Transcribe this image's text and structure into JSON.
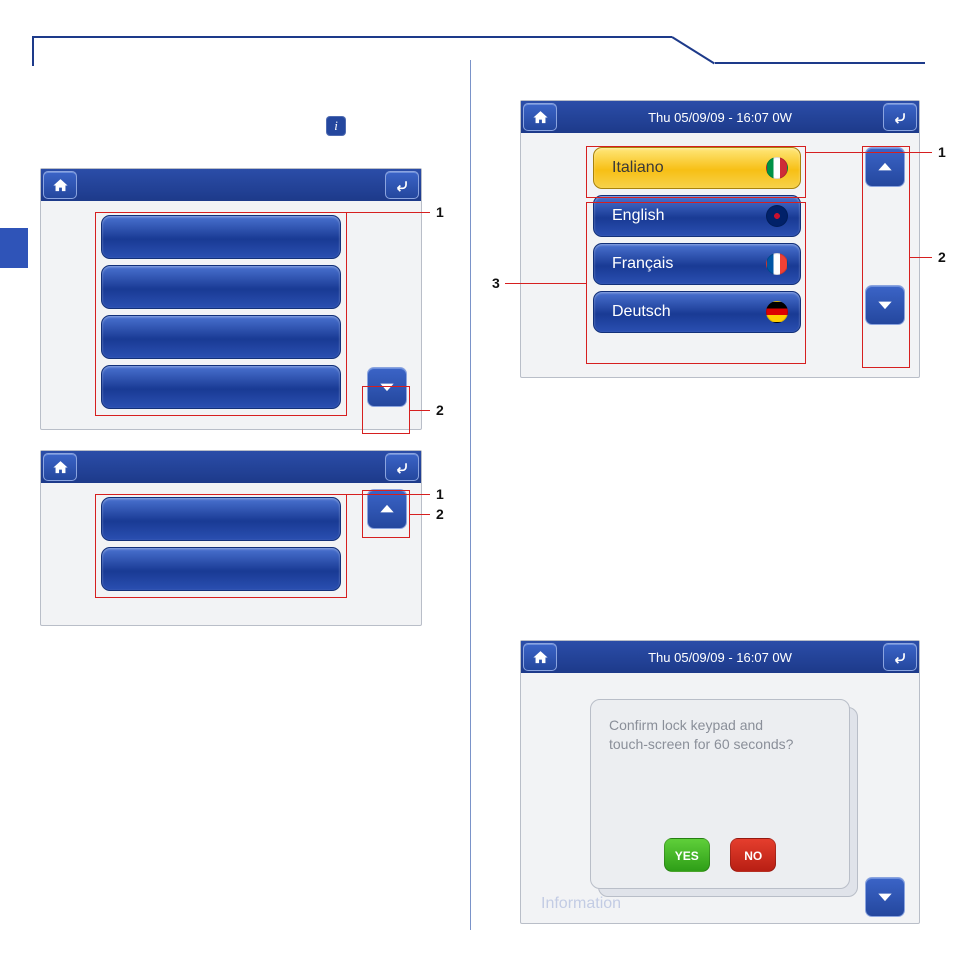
{
  "status_bar": "Thu 05/09/09 - 16:07   0W",
  "languages": {
    "selected": "Italiano",
    "others": [
      "English",
      "Français",
      "Deutsch"
    ]
  },
  "dialog": {
    "line1": "Confirm lock keypad and",
    "line2": "touch-screen for 60 seconds?",
    "yes": "YES",
    "no": "NO",
    "background_item": "Information"
  },
  "callouts": {
    "n1": "1",
    "n2": "2",
    "n3": "3"
  },
  "info_icon": "i"
}
